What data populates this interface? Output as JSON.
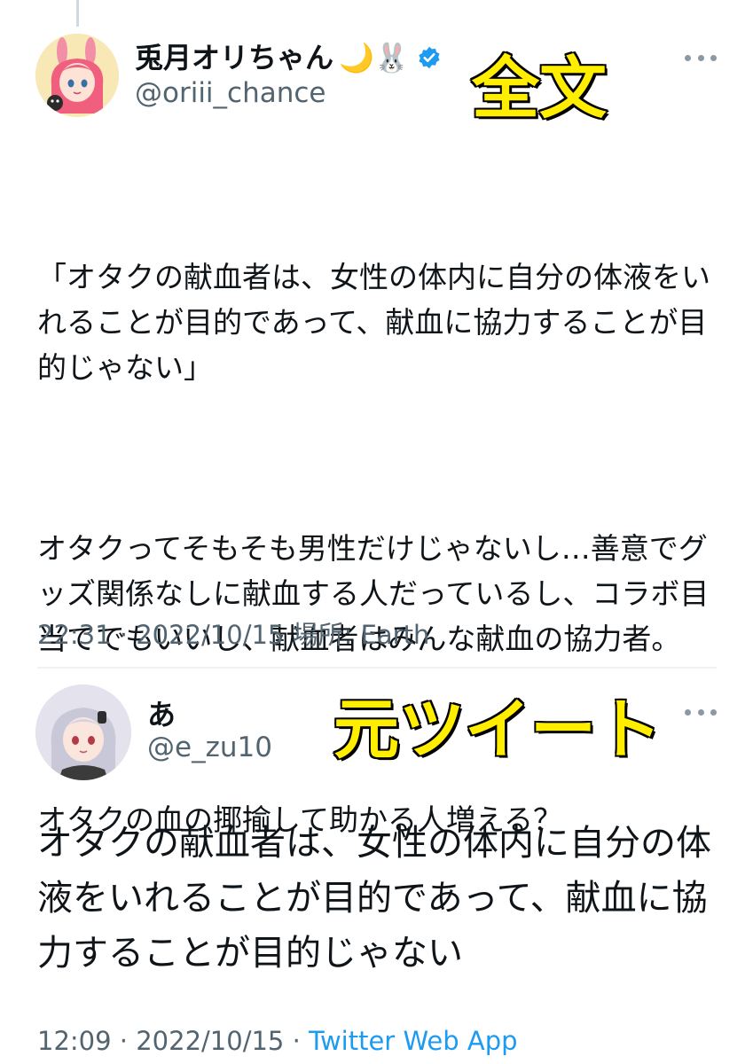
{
  "overlay_captions": {
    "top": "全文",
    "bottom": "元ツイート"
  },
  "tweet_full": {
    "display_name": "兎月オリちゃん",
    "name_emojis": "🌙🐰",
    "handle": "@oriii_chance",
    "verified": true,
    "paragraphs": [
      "「オタクの献血者は、女性の体内に自分の体液をいれることが目的であって、献血に協力することが目的じゃない」",
      "オタクってそもそも男性だけじゃないし…善意でグッズ関係なしに献血する人だっているし、コラボ目当てでもいいし、献血者はみんな献血の協力者。",
      "オタクの血の揶揄して助かる人増える？"
    ],
    "timestamp": "22:31 · 2022/10/15 場所: Earth"
  },
  "tweet_original": {
    "display_name": "あ",
    "handle": "@e_zu10",
    "text": "オタクの献血者は、女性の体内に自分の体液をいれることが目的であって、献血に協力することが目的じゃない",
    "timestamp": "12:09 · 2022/10/15 · ",
    "source_app": "Twitter Web App"
  },
  "colors": {
    "caption_fill": "#ffee00",
    "caption_stroke": "#000000",
    "verified_badge": "#1d9bf0",
    "secondary_text": "#536471",
    "link": "#1d9bf0"
  },
  "icons": {
    "verified": "verified-badge-icon",
    "more": "more-options-icon"
  }
}
